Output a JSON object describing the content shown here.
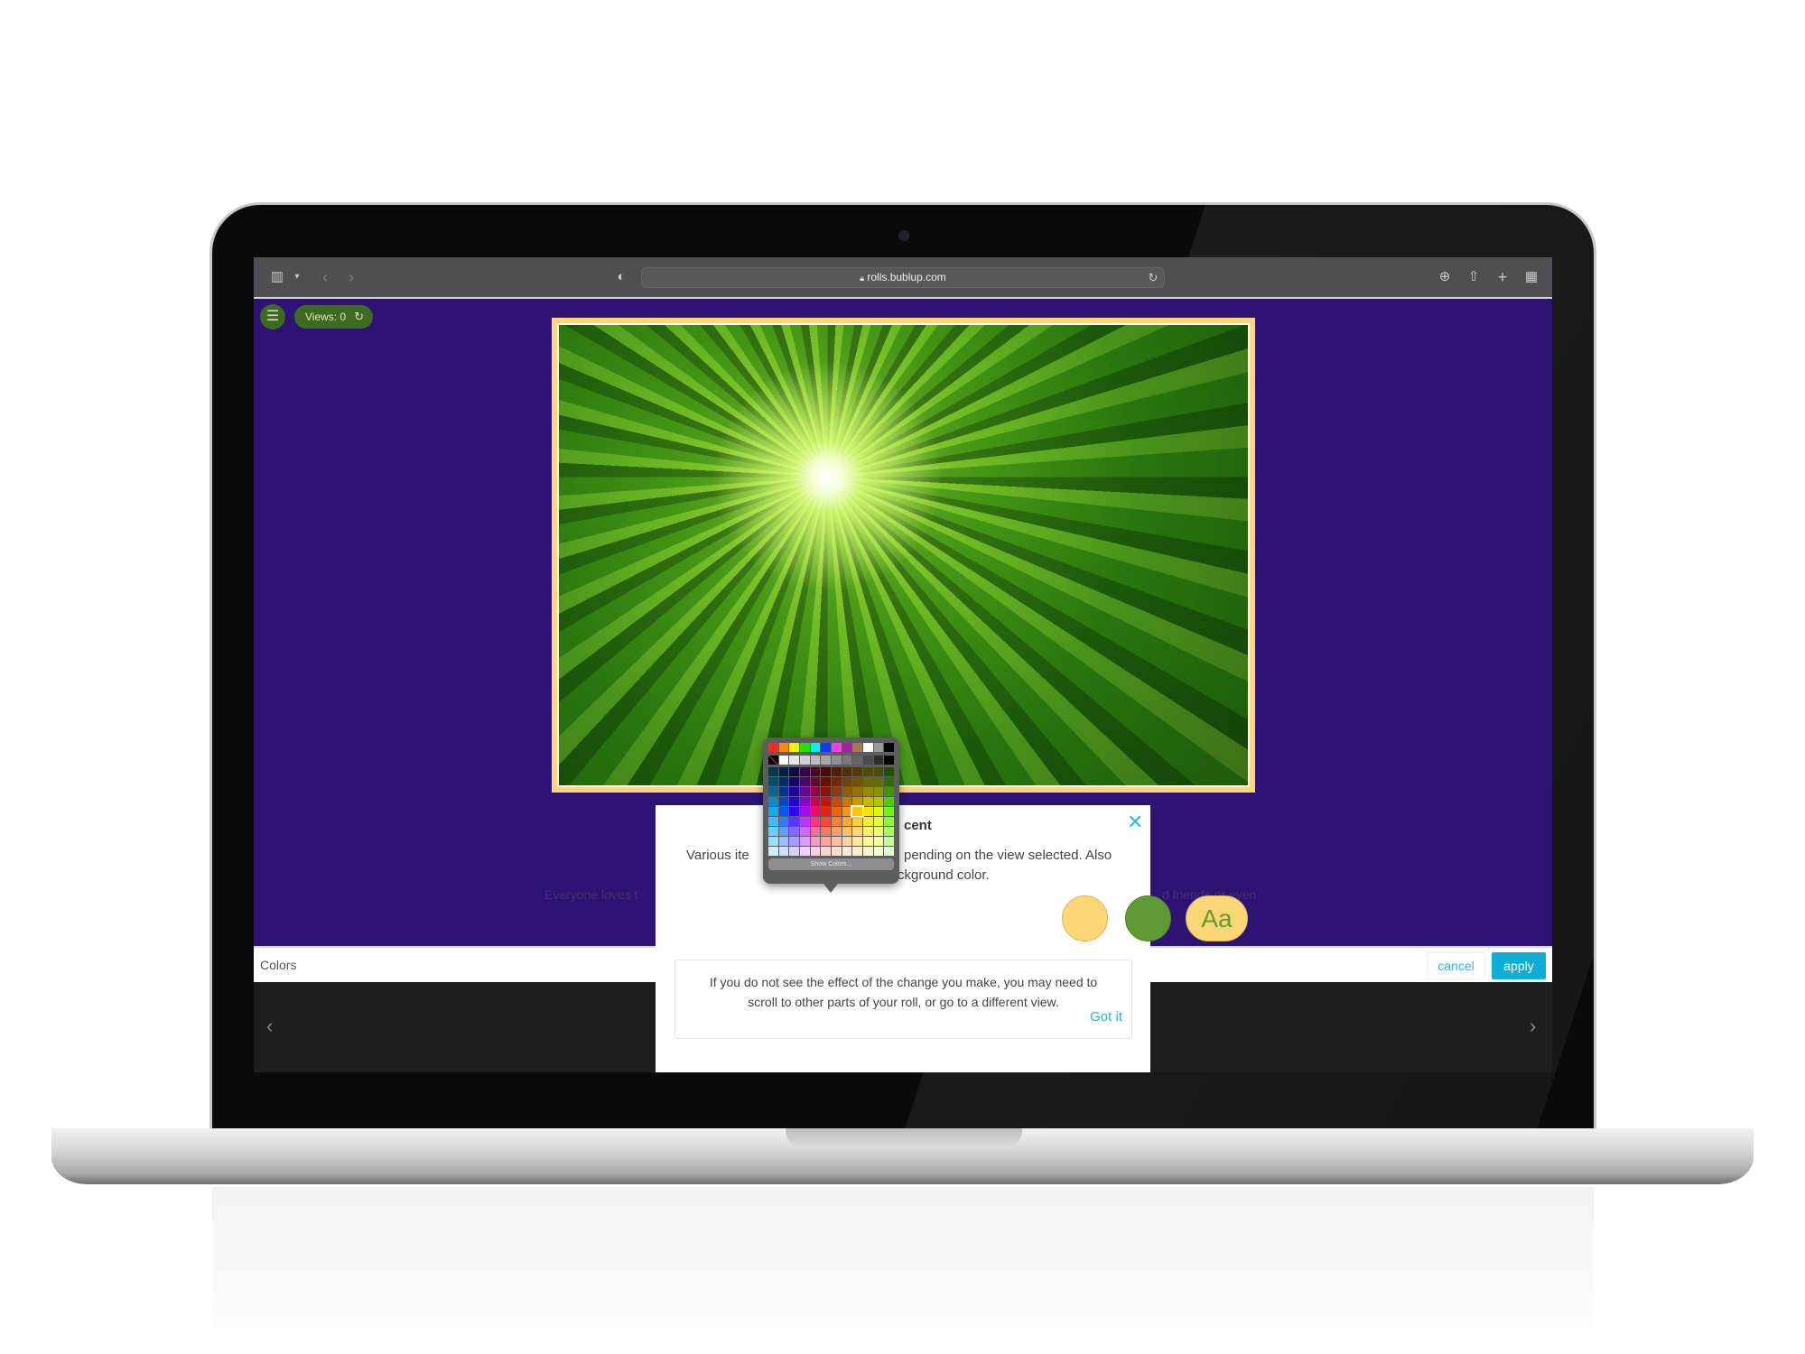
{
  "browser": {
    "url": "rolls.bublup.com",
    "icons": [
      "sidebar-icon",
      "chevron-down-icon",
      "back-icon",
      "forward-icon",
      "shield-icon",
      "lock-icon",
      "reload-icon",
      "download-icon",
      "share-icon",
      "new-tab-icon",
      "tab-overview-icon"
    ]
  },
  "app": {
    "views_label": "Views: 0",
    "background_color": "#2d1473",
    "background_text_left": "Everyone loves t",
    "background_text_right": "d friends or even"
  },
  "bottom_bar": {
    "label": "Colors",
    "cancel": "cancel",
    "apply": "apply"
  },
  "dialog": {
    "title_fragment": "cent",
    "line1_left": "Various ite",
    "line1_right": "pending on the view selected. Also",
    "line2_right": "ckground color.",
    "swatches": {
      "accent": "#fdd676",
      "secondary": "#5f9a35",
      "text_sample": "Aa"
    },
    "info_line1": "If you do not see the effect of the change you make, you may need to",
    "info_line2": "scroll to other parts of your roll, or go to a different view.",
    "got_it": "Got it"
  },
  "color_picker": {
    "top_row": [
      "#ff2a1a",
      "#ff8a00",
      "#ffee00",
      "#22e000",
      "#00f0ff",
      "#0a3cff",
      "#ff3cf0",
      "#a020a8",
      "#a97a52",
      "#ffffff",
      "#9a9a9a",
      "#000000"
    ],
    "gray_row": [
      "none",
      "#ffffff",
      "#e8e8e8",
      "#d2d2d2",
      "#bcbcbc",
      "#a6a6a6",
      "#909090",
      "#7a7a7a",
      "#646464",
      "#4a4a4a",
      "#2e2e2e",
      "#000000"
    ],
    "selected": "#ffc400",
    "show_colors": "Show Colors..."
  }
}
